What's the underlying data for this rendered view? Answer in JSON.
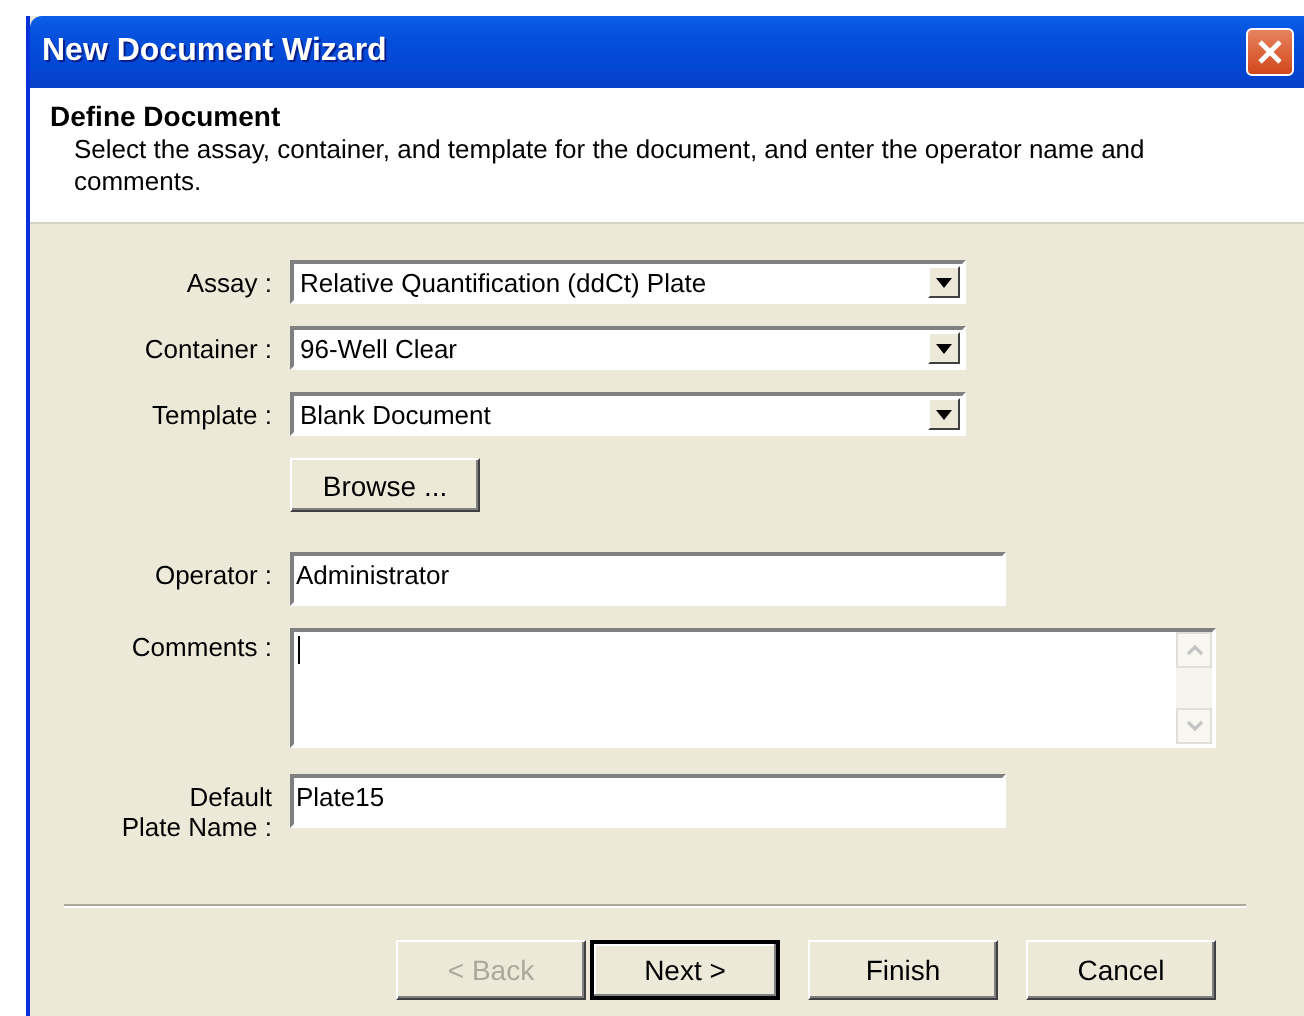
{
  "window": {
    "title": "New Document Wizard"
  },
  "header": {
    "title": "Define Document",
    "description": "Select the assay, container, and template for the document, and enter the operator name and comments."
  },
  "fields": [
    {
      "kind": "dropdown",
      "label": "Assay :",
      "value": "Relative Quantification (ddCt) Plate"
    },
    {
      "kind": "dropdown",
      "label": "Container :",
      "value": "96-Well Clear"
    },
    {
      "kind": "dropdown",
      "label": "Template :",
      "value": "Blank Document"
    },
    {
      "kind": "button",
      "label": "Browse ..."
    },
    {
      "kind": "text",
      "label": "Operator :",
      "value": "Administrator"
    },
    {
      "kind": "textarea",
      "label": "Comments :"
    },
    {
      "kind": "text",
      "label": "Default\nPlate Name :",
      "value": "Plate15"
    }
  ],
  "buttons": [
    {
      "label": "< Back",
      "disabled": true,
      "default": false
    },
    {
      "label": "Next >",
      "disabled": false,
      "default": true
    },
    {
      "label": "Finish",
      "disabled": false,
      "default": false
    },
    {
      "label": "Cancel",
      "disabled": false,
      "default": false
    }
  ]
}
